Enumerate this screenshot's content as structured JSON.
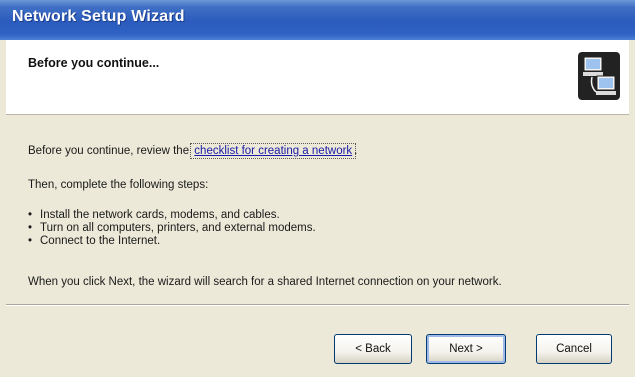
{
  "window": {
    "title": "Network Setup Wizard"
  },
  "header": {
    "heading": "Before you continue...",
    "icon": "network-computers-icon"
  },
  "content": {
    "intro_prefix": "Before you continue, review the ",
    "checklist_link": "checklist for creating a network",
    "intro_suffix": ".",
    "steps_intro": "Then, complete the following steps:",
    "steps": [
      "Install the network cards, modems, and cables.",
      "Turn on all computers, printers, and external modems.",
      "Connect to the Internet."
    ],
    "note": "When you click Next, the wizard will search for a shared Internet connection on your network."
  },
  "buttons": {
    "back": "< Back",
    "next": "Next >",
    "cancel": "Cancel"
  },
  "colors": {
    "titlebar": "#2a5bbd",
    "dialog_bg": "#ece9d8",
    "link": "#1a1aa8"
  }
}
